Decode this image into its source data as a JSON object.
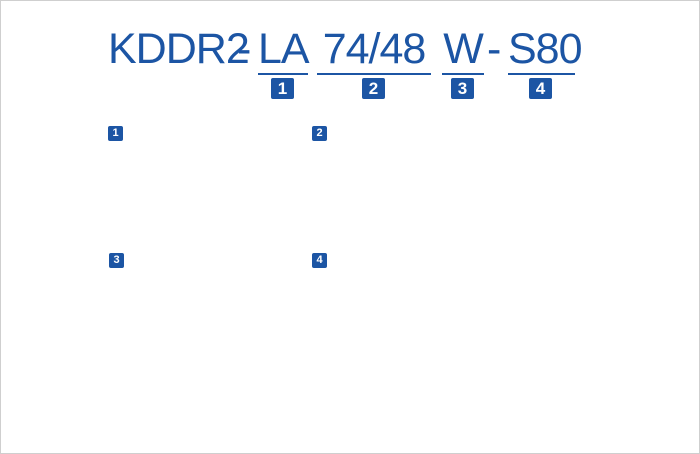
{
  "model_code": {
    "prefix": "KDDR2",
    "sep1": "-",
    "segment1": "LA",
    "segment2": "74/48",
    "segment3": "W",
    "sep2": "-",
    "segment4": "S80"
  },
  "badges": [
    "1",
    "2",
    "3",
    "4"
  ],
  "sections": [
    {
      "badge": "1"
    },
    {
      "badge": "2"
    },
    {
      "badge": "3"
    },
    {
      "badge": "4"
    }
  ],
  "colors": {
    "accent": "#1c55a4",
    "border": "#cfcfcf",
    "background": "#ffffff"
  }
}
